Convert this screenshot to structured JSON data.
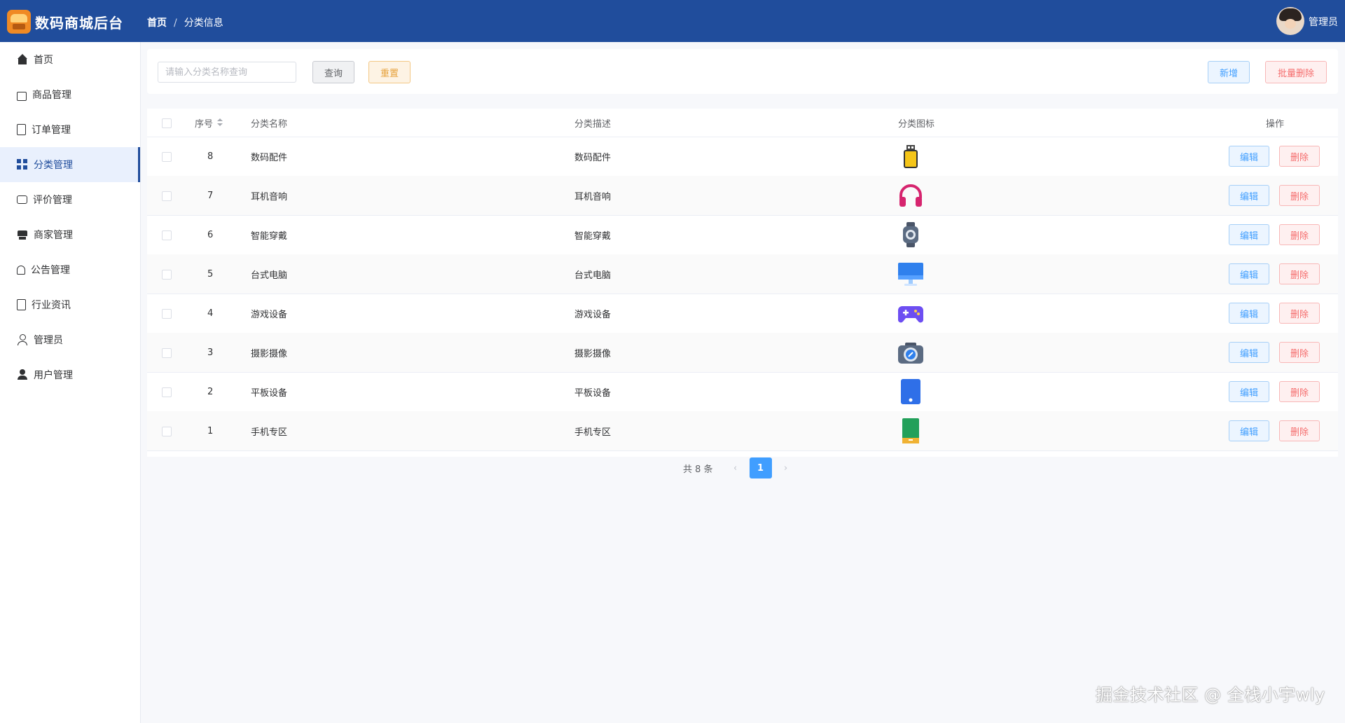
{
  "header": {
    "app_title": "数码商城后台",
    "breadcrumb_home": "首页",
    "breadcrumb_sep": "/",
    "breadcrumb_current": "分类信息",
    "admin_name": "管理员"
  },
  "sidebar": {
    "items": [
      {
        "label": "首页",
        "icon": "home-icon"
      },
      {
        "label": "商品管理",
        "icon": "bag-icon"
      },
      {
        "label": "订单管理",
        "icon": "document-icon"
      },
      {
        "label": "分类管理",
        "icon": "grid-icon",
        "active": true
      },
      {
        "label": "评价管理",
        "icon": "chat-icon"
      },
      {
        "label": "商家管理",
        "icon": "shop-icon"
      },
      {
        "label": "公告管理",
        "icon": "bell-icon"
      },
      {
        "label": "行业资讯",
        "icon": "document-icon"
      },
      {
        "label": "管理员",
        "icon": "user-icon"
      },
      {
        "label": "用户管理",
        "icon": "user-filled-icon"
      }
    ]
  },
  "toolbar": {
    "search_placeholder": "请输入分类名称查询",
    "query_label": "查询",
    "reset_label": "重置",
    "add_label": "新增",
    "batch_delete_label": "批量删除"
  },
  "table": {
    "columns": {
      "index": "序号",
      "name": "分类名称",
      "description": "分类描述",
      "icon": "分类图标",
      "actions": "操作"
    },
    "edit_label": "编辑",
    "delete_label": "删除",
    "rows": [
      {
        "id": "8",
        "name": "数码配件",
        "description": "数码配件",
        "icon": "usb-drive-icon"
      },
      {
        "id": "7",
        "name": "耳机音响",
        "description": "耳机音响",
        "icon": "headphones-icon"
      },
      {
        "id": "6",
        "name": "智能穿戴",
        "description": "智能穿戴",
        "icon": "smartwatch-icon"
      },
      {
        "id": "5",
        "name": "台式电脑",
        "description": "台式电脑",
        "icon": "desktop-monitor-icon"
      },
      {
        "id": "4",
        "name": "游戏设备",
        "description": "游戏设备",
        "icon": "gamepad-icon"
      },
      {
        "id": "3",
        "name": "摄影摄像",
        "description": "摄影摄像",
        "icon": "camera-icon"
      },
      {
        "id": "2",
        "name": "平板设备",
        "description": "平板设备",
        "icon": "tablet-icon"
      },
      {
        "id": "1",
        "name": "手机专区",
        "description": "手机专区",
        "icon": "phone-icon"
      }
    ]
  },
  "pagination": {
    "total_label": "共 8 条",
    "prev": "‹",
    "next": "›",
    "current_page": "1"
  },
  "watermark": "掘金技术社区 @ 全栈小宇wly",
  "colors": {
    "header_bg": "#204d9c",
    "primary": "#409eff",
    "danger": "#f56c6c",
    "warning": "#e6a23c"
  }
}
